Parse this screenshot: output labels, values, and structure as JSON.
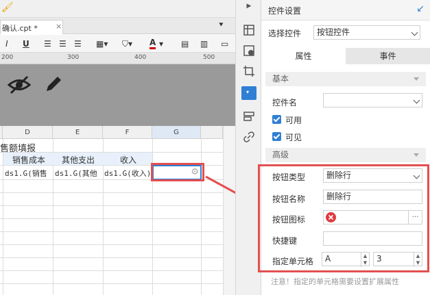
{
  "editor": {
    "file_tab": "确认.cpt *",
    "tab_close": "×",
    "ruler_ticks": [
      "200",
      "300",
      "400",
      "500"
    ],
    "columns": [
      "D",
      "E",
      "F",
      "G"
    ],
    "title_cell": "售额填报",
    "header_cells": [
      "销售成本",
      "其他支出",
      "收入"
    ],
    "data_cells": [
      "ds1.G(销售",
      "ds1.G(其他",
      "ds1.G(收入)"
    ]
  },
  "panel": {
    "title": "控件设置",
    "select_widget_label": "选择控件",
    "select_widget_value": "按钮控件",
    "tabs": [
      "属性",
      "事件"
    ],
    "basic_section": "基本",
    "widget_name_label": "控件名",
    "widget_name_value": "",
    "enabled_label": "可用",
    "visible_label": "可见",
    "advanced_section": "高级",
    "button_type_label": "按钮类型",
    "button_type_value": "删除行",
    "button_name_label": "按钮名称",
    "button_name_value": "删除行",
    "button_icon_label": "按钮图标",
    "button_icon_more": "···",
    "shortcut_label": "快捷键",
    "shortcut_value": "",
    "target_cell_label": "指定单元格",
    "target_col_value": "A",
    "target_row_value": "3",
    "note": "注意！指定的单元格需要设置扩展属性"
  },
  "colors": {
    "highlight": "#e34f4f",
    "accent": "#2f7fd4",
    "delete_icon": "#e0393e"
  }
}
